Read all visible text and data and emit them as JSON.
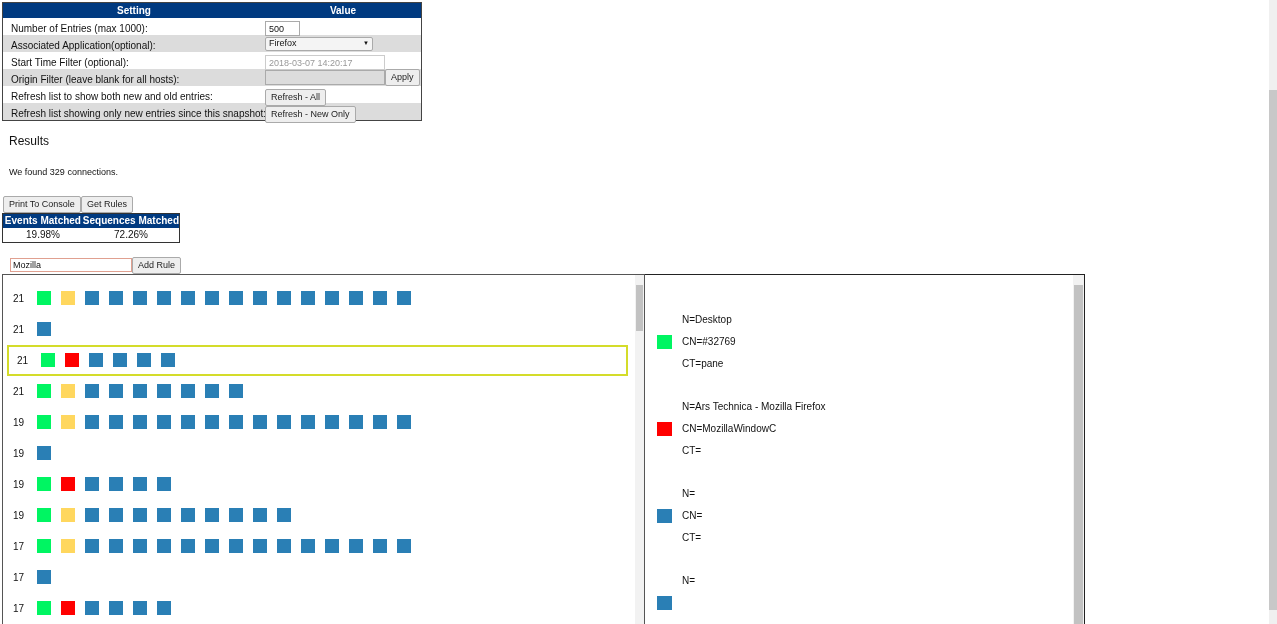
{
  "settings": {
    "columns": [
      "Setting",
      "Value"
    ],
    "rows": [
      {
        "kind": "text-input",
        "label": "Number of Entries (max 1000):",
        "value": "500"
      },
      {
        "kind": "select",
        "label": "Associated Application(optional):",
        "value": "Firefox",
        "caret": "▼"
      },
      {
        "kind": "placeholder-input",
        "label": "Start Time Filter (optional):",
        "placeholder": "2018-03-07 14:20:17"
      },
      {
        "kind": "input-button",
        "label": "Origin Filter (leave blank for all hosts):",
        "button": "Apply"
      },
      {
        "kind": "button",
        "label": "Refresh list to show both new and old entries:",
        "button": "Refresh - All"
      },
      {
        "kind": "button",
        "label": "Refresh list showing only new entries since this snapshot:",
        "button": "Refresh - New Only"
      }
    ]
  },
  "results": {
    "heading": "Results",
    "summary": "We found 329 connections.",
    "buttons": [
      "Print To Console",
      "Get Rules"
    ],
    "stats": {
      "columns": [
        "Events Matched",
        "Sequences Matched"
      ],
      "values": [
        "19.98%",
        "72.26%"
      ]
    },
    "rule_input": {
      "value": "Mozilla",
      "button": "Add Rule"
    }
  },
  "sequences": [
    {
      "count": "21",
      "selected": false,
      "squares": [
        {
          "color": "#00f562"
        },
        {
          "color": "#ffd75e"
        },
        {
          "color": "#2a7fb5"
        },
        {
          "color": "#2a7fb5"
        },
        {
          "color": "#2a7fb5"
        },
        {
          "color": "#2a7fb5"
        },
        {
          "color": "#2a7fb5"
        },
        {
          "color": "#2a7fb5"
        },
        {
          "color": "#2a7fb5"
        },
        {
          "color": "#2a7fb5"
        },
        {
          "color": "#2a7fb5"
        },
        {
          "color": "#2a7fb5"
        },
        {
          "color": "#2a7fb5"
        },
        {
          "color": "#2a7fb5"
        },
        {
          "color": "#2a7fb5"
        },
        {
          "color": "#2a7fb5"
        }
      ]
    },
    {
      "count": "21",
      "selected": false,
      "squares": [
        {
          "color": "#2a7fb5"
        }
      ]
    },
    {
      "count": "21",
      "selected": true,
      "squares": [
        {
          "color": "#00f562"
        },
        {
          "color": "#ff0000"
        },
        {
          "color": "#2a7fb5"
        },
        {
          "color": "#2a7fb5"
        },
        {
          "color": "#2a7fb5"
        },
        {
          "color": "#2a7fb5"
        }
      ]
    },
    {
      "count": "21",
      "selected": false,
      "squares": [
        {
          "color": "#00f562"
        },
        {
          "color": "#ffd75e"
        },
        {
          "color": "#2a7fb5"
        },
        {
          "color": "#2a7fb5"
        },
        {
          "color": "#2a7fb5"
        },
        {
          "color": "#2a7fb5"
        },
        {
          "color": "#2a7fb5"
        },
        {
          "color": "#2a7fb5"
        },
        {
          "color": "#2a7fb5"
        }
      ]
    },
    {
      "count": "19",
      "selected": false,
      "squares": [
        {
          "color": "#00f562"
        },
        {
          "color": "#ffd75e"
        },
        {
          "color": "#2a7fb5"
        },
        {
          "color": "#2a7fb5"
        },
        {
          "color": "#2a7fb5"
        },
        {
          "color": "#2a7fb5"
        },
        {
          "color": "#2a7fb5"
        },
        {
          "color": "#2a7fb5"
        },
        {
          "color": "#2a7fb5"
        },
        {
          "color": "#2a7fb5"
        },
        {
          "color": "#2a7fb5"
        },
        {
          "color": "#2a7fb5"
        },
        {
          "color": "#2a7fb5"
        },
        {
          "color": "#2a7fb5"
        },
        {
          "color": "#2a7fb5"
        },
        {
          "color": "#2a7fb5"
        }
      ]
    },
    {
      "count": "19",
      "selected": false,
      "squares": [
        {
          "color": "#2a7fb5"
        }
      ]
    },
    {
      "count": "19",
      "selected": false,
      "squares": [
        {
          "color": "#00f562"
        },
        {
          "color": "#ff0000"
        },
        {
          "color": "#2a7fb5"
        },
        {
          "color": "#2a7fb5"
        },
        {
          "color": "#2a7fb5"
        },
        {
          "color": "#2a7fb5"
        }
      ]
    },
    {
      "count": "19",
      "selected": false,
      "squares": [
        {
          "color": "#00f562"
        },
        {
          "color": "#ffd75e"
        },
        {
          "color": "#2a7fb5"
        },
        {
          "color": "#2a7fb5"
        },
        {
          "color": "#2a7fb5"
        },
        {
          "color": "#2a7fb5"
        },
        {
          "color": "#2a7fb5"
        },
        {
          "color": "#2a7fb5"
        },
        {
          "color": "#2a7fb5"
        },
        {
          "color": "#2a7fb5"
        },
        {
          "color": "#2a7fb5"
        }
      ]
    },
    {
      "count": "17",
      "selected": false,
      "squares": [
        {
          "color": "#00f562"
        },
        {
          "color": "#ffd75e"
        },
        {
          "color": "#2a7fb5"
        },
        {
          "color": "#2a7fb5"
        },
        {
          "color": "#2a7fb5"
        },
        {
          "color": "#2a7fb5"
        },
        {
          "color": "#2a7fb5"
        },
        {
          "color": "#2a7fb5"
        },
        {
          "color": "#2a7fb5"
        },
        {
          "color": "#2a7fb5"
        },
        {
          "color": "#2a7fb5"
        },
        {
          "color": "#2a7fb5"
        },
        {
          "color": "#2a7fb5"
        },
        {
          "color": "#2a7fb5"
        },
        {
          "color": "#2a7fb5"
        },
        {
          "color": "#2a7fb5"
        }
      ]
    },
    {
      "count": "17",
      "selected": false,
      "squares": [
        {
          "color": "#2a7fb5"
        }
      ]
    },
    {
      "count": "17",
      "selected": false,
      "squares": [
        {
          "color": "#00f562"
        },
        {
          "color": "#ff0000"
        },
        {
          "color": "#2a7fb5"
        },
        {
          "color": "#2a7fb5"
        },
        {
          "color": "#2a7fb5"
        },
        {
          "color": "#2a7fb5"
        }
      ]
    }
  ],
  "details": [
    {
      "color": "#00f562",
      "lines": [
        "N=Desktop",
        "CN=#32769",
        "CT=pane"
      ]
    },
    {
      "color": "#ff0000",
      "lines": [
        "N=Ars Technica - Mozilla Firefox",
        "CN=MozillaWindowC",
        "CT="
      ]
    },
    {
      "color": "#2a7fb5",
      "lines": [
        "N=",
        "CN=",
        "CT="
      ]
    },
    {
      "color": "#2a7fb5",
      "lines": [
        "N="
      ]
    }
  ]
}
